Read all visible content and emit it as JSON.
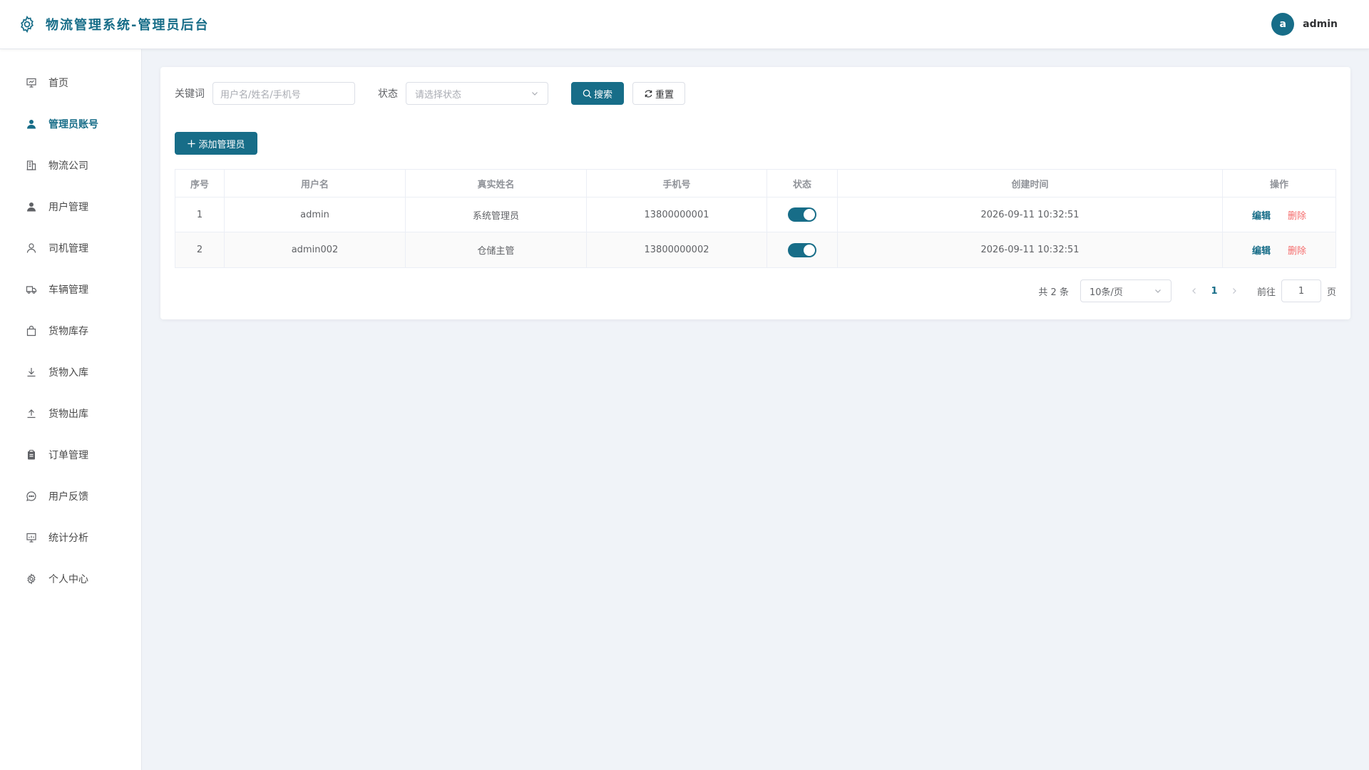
{
  "header": {
    "title": "物流管理系统-管理员后台",
    "avatar_letter": "a",
    "username": "admin"
  },
  "sidebar": {
    "items": [
      {
        "label": "首页",
        "icon": "dashboard-icon"
      },
      {
        "label": "管理员账号",
        "icon": "user-filled-icon",
        "active": true
      },
      {
        "label": "物流公司",
        "icon": "building-icon"
      },
      {
        "label": "用户管理",
        "icon": "user-filled-icon"
      },
      {
        "label": "司机管理",
        "icon": "user-outline-icon"
      },
      {
        "label": "车辆管理",
        "icon": "truck-icon"
      },
      {
        "label": "货物库存",
        "icon": "bag-icon"
      },
      {
        "label": "货物入库",
        "icon": "download-icon"
      },
      {
        "label": "货物出库",
        "icon": "upload-icon"
      },
      {
        "label": "订单管理",
        "icon": "clipboard-icon"
      },
      {
        "label": "用户反馈",
        "icon": "chat-icon"
      },
      {
        "label": "统计分析",
        "icon": "chart-board-icon"
      },
      {
        "label": "个人中心",
        "icon": "gear-icon"
      }
    ]
  },
  "search": {
    "keyword_label": "关键词",
    "keyword_placeholder": "用户名/姓名/手机号",
    "status_label": "状态",
    "status_placeholder": "请选择状态",
    "search_button": "搜索",
    "reset_button": "重置"
  },
  "add_button": "添加管理员",
  "table": {
    "headers": [
      "序号",
      "用户名",
      "真实姓名",
      "手机号",
      "状态",
      "创建时间",
      "操作"
    ],
    "rows": [
      {
        "index": "1",
        "username": "admin",
        "real_name": "系统管理员",
        "phone": "13800000001",
        "enabled": true,
        "created": "2026-09-11 10:32:51"
      },
      {
        "index": "2",
        "username": "admin002",
        "real_name": "仓储主管",
        "phone": "13800000002",
        "enabled": true,
        "created": "2026-09-11 10:32:51"
      }
    ],
    "edit_label": "编辑",
    "delete_label": "删除"
  },
  "pagination": {
    "total_text": "共 2 条",
    "page_size": "10条/页",
    "current_page": "1",
    "goto_label": "前往",
    "goto_value": "1",
    "page_suffix": "页"
  },
  "colors": {
    "primary": "#176d88",
    "danger": "#f56c6c",
    "background": "#f0f3f8"
  }
}
